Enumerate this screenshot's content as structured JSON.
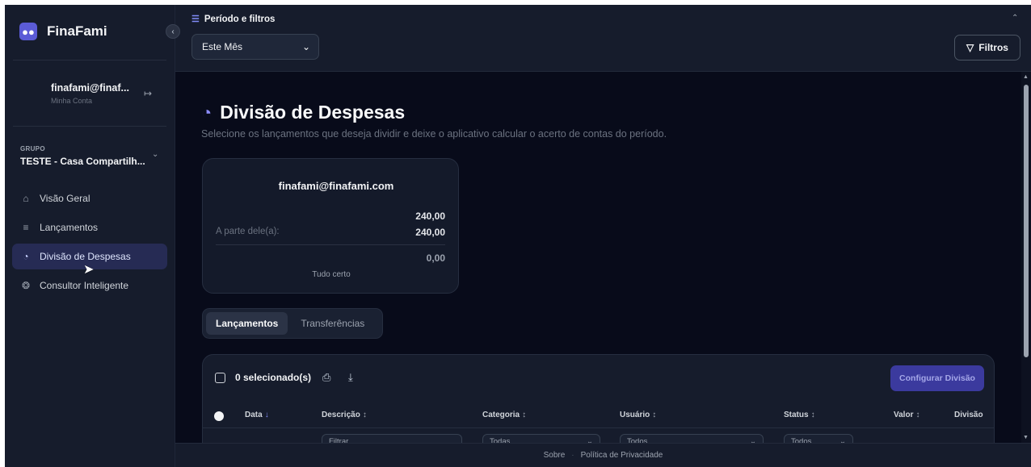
{
  "app": {
    "name": "FinaFami",
    "logo_icon": "users-icon",
    "collapse_icon": "chevron-left-icon"
  },
  "account": {
    "email": "finafami@finaf...",
    "subtitle": "Minha Conta",
    "logout_icon": "logout-icon"
  },
  "group": {
    "label": "GRUPO",
    "name": "TESTE - Casa Compartilh...",
    "chevron_icon": "chevron-down-icon"
  },
  "nav": [
    {
      "label": "Visão Geral",
      "icon": "home-icon",
      "active": false
    },
    {
      "label": "Lançamentos",
      "icon": "list-icon",
      "active": false
    },
    {
      "label": "Divisão de Despesas",
      "icon": "pie-chart-icon",
      "active": true
    },
    {
      "label": "Consultor Inteligente",
      "icon": "brain-icon",
      "active": false
    }
  ],
  "topbar": {
    "section_title": "Período e filtros",
    "period_value": "Este Mês",
    "filters_label": "Filtros"
  },
  "page": {
    "title": "Divisão de Despesas",
    "subtitle": "Selecione os lançamentos que deseja dividir e deixe o aplicativo calcular o acerto de contas do período."
  },
  "summary_card": {
    "email": "finafami@finafami.com",
    "value_1": "240,00",
    "share_label": "A parte dele(a):",
    "share_value": "240,00",
    "balance": "0,00",
    "status": "Tudo certo"
  },
  "tabs": [
    {
      "label": "Lançamentos",
      "active": true
    },
    {
      "label": "Transferências",
      "active": false
    }
  ],
  "table": {
    "selected_count": "0 selecionado(s)",
    "configure_button": "Configurar Divisão",
    "columns": {
      "data": "Data",
      "descricao": "Descrição",
      "categoria": "Categoria",
      "usuario": "Usuário",
      "status": "Status",
      "valor": "Valor",
      "divisao": "Divisão"
    },
    "filters": {
      "descricao_placeholder": "Filtrar...",
      "categoria_value": "Todas",
      "usuario_value": "Todos",
      "status_value": "Todos"
    }
  },
  "footer": {
    "about": "Sobre",
    "privacy": "Política de Privacidade"
  },
  "colors": {
    "background": "#080b1a",
    "sidebar": "#161c2c",
    "accent": "#818cf8",
    "active_nav": "#262b54",
    "primary_button": "#3b3a9e"
  }
}
